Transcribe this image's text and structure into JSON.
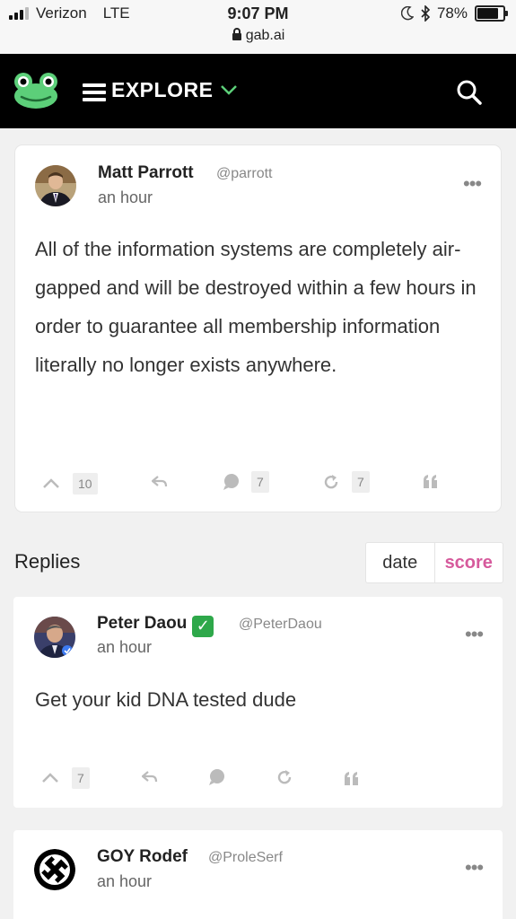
{
  "status_bar": {
    "carrier": "Verizon",
    "network": "LTE",
    "time": "9:07 PM",
    "url": "gab.ai",
    "battery": "78%"
  },
  "nav": {
    "explore_label": "EXPLORE"
  },
  "post": {
    "author": "Matt Parrott",
    "handle": "@parrott",
    "time": "an hour",
    "text": "All of the information systems are completely air-gapped and will be destroyed within a few hours in order to guarantee all membership information literally no longer exists anywhere.",
    "upvotes": "10",
    "comments": "7",
    "reposts": "7"
  },
  "replies": {
    "label": "Replies",
    "sort_date": "date",
    "sort_score": "score",
    "items": [
      {
        "author": "Peter Daou",
        "handle": "@PeterDaou",
        "time": "an hour",
        "text": "Get your kid DNA tested dude",
        "upvotes": "7",
        "verified_mark": "✓"
      },
      {
        "author": "GOY Rodef",
        "handle": "@ProleSerf",
        "time": "an hour"
      }
    ]
  },
  "colors": {
    "nav_bg": "#000000",
    "logo_green": "#5ccf79",
    "score_pink": "#d65a9c",
    "verified_green": "#2ea84a"
  },
  "icons": [
    "signal-icon",
    "lock-icon",
    "moon-icon",
    "bluetooth-icon",
    "battery-icon",
    "gab-frog-logo",
    "hamburger-icon",
    "chevron-down-icon",
    "search-icon",
    "more-icon",
    "upvote-icon",
    "reply-icon",
    "comment-icon",
    "repost-icon",
    "quote-icon",
    "verified-check-icon"
  ]
}
